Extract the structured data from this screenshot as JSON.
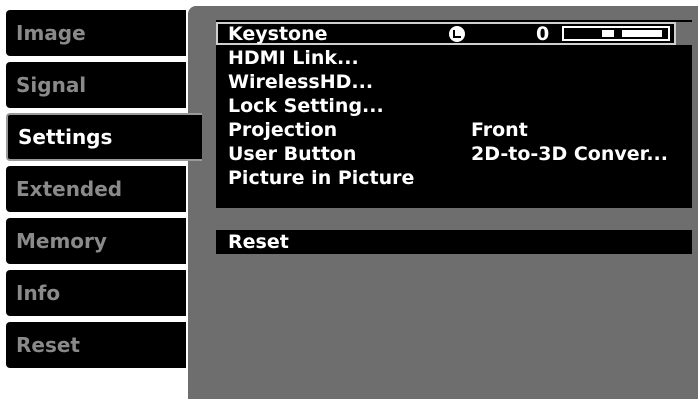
{
  "tabs": [
    {
      "label": "Image"
    },
    {
      "label": "Signal"
    },
    {
      "label": "Settings"
    },
    {
      "label": "Extended"
    },
    {
      "label": "Memory"
    },
    {
      "label": "Info"
    },
    {
      "label": "Reset"
    }
  ],
  "settings": {
    "rows": [
      {
        "label": "Keystone",
        "value": "0",
        "icon": "enter-icon",
        "slider_level": 0.5
      },
      {
        "label": "HDMI Link...",
        "value": ""
      },
      {
        "label": "WirelessHD...",
        "value": ""
      },
      {
        "label": "Lock Setting...",
        "value": ""
      },
      {
        "label": "Projection",
        "value": "Front"
      },
      {
        "label": "User Button",
        "value": "2D-to-3D Conver..."
      },
      {
        "label": "Picture in Picture",
        "value": ""
      }
    ],
    "reset_label": "Reset"
  },
  "colors": {
    "panel_bg": "#6e6e6e",
    "menu_bg": "#000000",
    "active_text": "#ffffff",
    "inactive_text": "#8a8a8a"
  }
}
